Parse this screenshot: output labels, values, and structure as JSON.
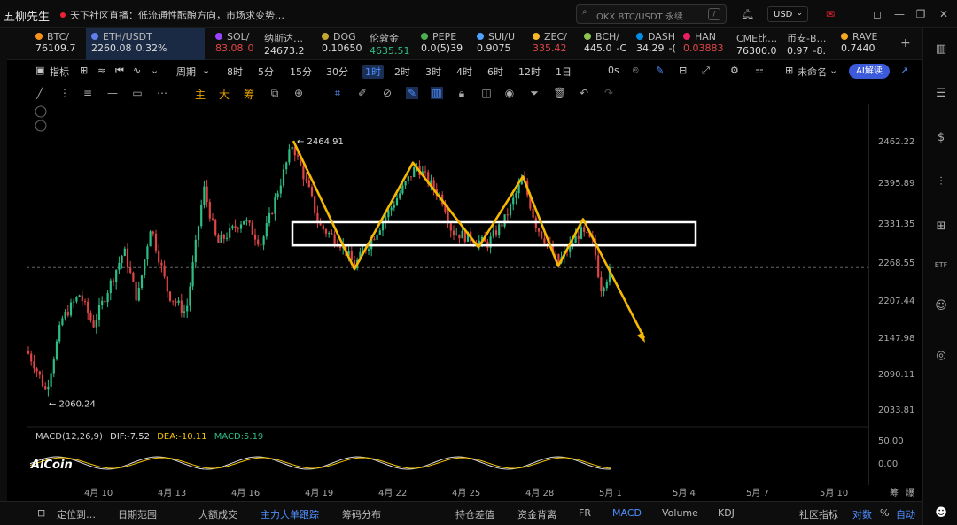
{
  "titlebar": {
    "app_name": "五柳先生",
    "broadcast": "天下社区直播：低流通性酝酿方向，市场求变势…",
    "search_placeholder": "OKX BTC/USDT 永续",
    "search_key": "/",
    "currency": "USD"
  },
  "tickers": [
    {
      "name": "BTC/",
      "price": "76109.7",
      "color": "#ddd",
      "icon": "#f7931a"
    },
    {
      "name": "ETH/USDT",
      "price": "2260.08",
      "change": "0.32%",
      "color": "#ddd",
      "icon": "#627eea",
      "active": true
    },
    {
      "name": "SOL/",
      "price": "83.08",
      "extra": "0",
      "color": "#e04545",
      "icon": "#9945ff"
    },
    {
      "name": "纳斯达…",
      "price": "24673.2",
      "color": "#ddd",
      "icon": ""
    },
    {
      "name": "DOG",
      "price": "0.10650",
      "color": "#ddd",
      "icon": "#c2a633"
    },
    {
      "name": "伦敦金",
      "price": "4635.51",
      "color": "#2ebd85",
      "icon": ""
    },
    {
      "name": "PEPE",
      "price": "0.0(5)39",
      "color": "#ddd",
      "icon": "#4caf50"
    },
    {
      "name": "SUI/U",
      "price": "0.9075",
      "color": "#ddd",
      "icon": "#4da2ff"
    },
    {
      "name": "ZEC/",
      "price": "335.42",
      "color": "#e04545",
      "icon": "#f4b728"
    },
    {
      "name": "BCH/",
      "price": "445.0",
      "extra": "-C",
      "color": "#ddd",
      "icon": "#8dc351"
    },
    {
      "name": "DASH",
      "price": "34.29",
      "extra": "-(",
      "color": "#ddd",
      "icon": "#008de4"
    },
    {
      "name": "HAN",
      "price": "0.03883",
      "color": "#e04545",
      "icon": "#e91e63"
    },
    {
      "name": "CME比…",
      "price": "76300.0",
      "color": "#ddd",
      "icon": ""
    },
    {
      "name": "币安-B…",
      "price": "0.97",
      "extra": "-8.",
      "color": "#ddd",
      "icon": ""
    },
    {
      "name": "RAVE",
      "price": "0.7440",
      "color": "#ddd",
      "icon": "#f5a623"
    }
  ],
  "toolbar": {
    "indicator": "指标",
    "period": "周期",
    "intervals": [
      "8时",
      "5分",
      "15分",
      "30分",
      "1时",
      "2时",
      "3时",
      "4时",
      "6时",
      "12时",
      "1日"
    ],
    "selected": "1时",
    "countdown": "0s",
    "layout": "未命名",
    "ai": "AI解读"
  },
  "drawbar": {
    "labels": [
      "主",
      "大",
      "筹"
    ]
  },
  "chart_data": {
    "type": "candlestick",
    "title": "ETH/USDT 1时",
    "y_ticks": [
      2462.22,
      2395.89,
      2331.35,
      2268.55,
      2207.44,
      2147.98,
      2090.11,
      2033.81
    ],
    "x_ticks": [
      "4月 10",
      "4月 13",
      "4月 16",
      "4月 19",
      "4月 22",
      "4月 25",
      "4月 28",
      "5月 1",
      "5月 4",
      "5月 7",
      "5月 10"
    ],
    "high_label": "2464.91",
    "low_label": "2060.24",
    "current_price": 2262.5,
    "zigzag": [
      [
        2464.91
      ],
      [
        2260
      ],
      [
        2430
      ],
      [
        2295
      ],
      [
        2408
      ],
      [
        2265
      ],
      [
        2340
      ],
      [
        2150
      ]
    ],
    "range_box": {
      "top": 2335,
      "bottom": 2298
    },
    "macd": {
      "label": "MACD(12,26,9)",
      "dif": "DIF:-7.52",
      "dea": "DEA:-10.11",
      "macd": "MACD:5.19",
      "y_ticks": [
        "50.00",
        "0.00"
      ]
    }
  },
  "logo": "AiCoin",
  "bottom": {
    "items": [
      "定位到…",
      "日期范围",
      "大额成交",
      "主力大单跟踪",
      "筹码分布",
      "持仓差值",
      "资金背离",
      "FR",
      "MACD",
      "Volume",
      "KDJ",
      "社区指标",
      "对数",
      "%",
      "自动"
    ]
  },
  "corner": {
    "label_a": "筹",
    "label_b": "爆"
  }
}
